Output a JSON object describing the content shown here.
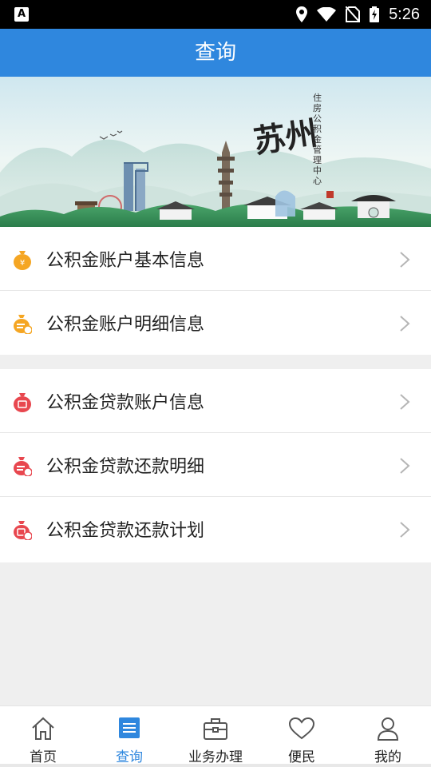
{
  "status_bar": {
    "time": "5:26",
    "left_icon": "A"
  },
  "header": {
    "title": "查询"
  },
  "banner": {
    "city": "苏州",
    "org_name": "住房公积金管理中心",
    "seal": "印"
  },
  "groups": [
    {
      "items": [
        {
          "label": "公积金账户基本信息",
          "icon": "coin-bag-icon",
          "color": "#f5a623"
        },
        {
          "label": "公积金账户明细信息",
          "icon": "coin-bag-detail-icon",
          "color": "#f5a623"
        }
      ]
    },
    {
      "items": [
        {
          "label": "公积金贷款账户信息",
          "icon": "loan-bag-icon",
          "color": "#e8474f"
        },
        {
          "label": "公积金贷款还款明细",
          "icon": "loan-repay-detail-icon",
          "color": "#e8474f"
        },
        {
          "label": "公积金贷款还款计划",
          "icon": "loan-repay-plan-icon",
          "color": "#e8474f"
        }
      ]
    }
  ],
  "bottom_nav": [
    {
      "label": "首页",
      "icon": "home-icon",
      "active": false
    },
    {
      "label": "查询",
      "icon": "query-list-icon",
      "active": true
    },
    {
      "label": "业务办理",
      "icon": "briefcase-icon",
      "active": false
    },
    {
      "label": "便民",
      "icon": "heart-icon",
      "active": false
    },
    {
      "label": "我的",
      "icon": "user-icon",
      "active": false
    }
  ],
  "colors": {
    "accent": "#2f87de",
    "orange": "#f5a623",
    "red": "#e8474f"
  }
}
